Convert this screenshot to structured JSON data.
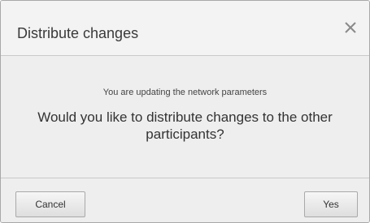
{
  "dialog": {
    "title": "Distribute changes",
    "close_icon": "close-icon",
    "subtitle": "You are updating the network parameters",
    "question": "Would you like to distribute changes to the other participants?",
    "buttons": {
      "cancel_label": "Cancel",
      "yes_label": "Yes"
    }
  }
}
